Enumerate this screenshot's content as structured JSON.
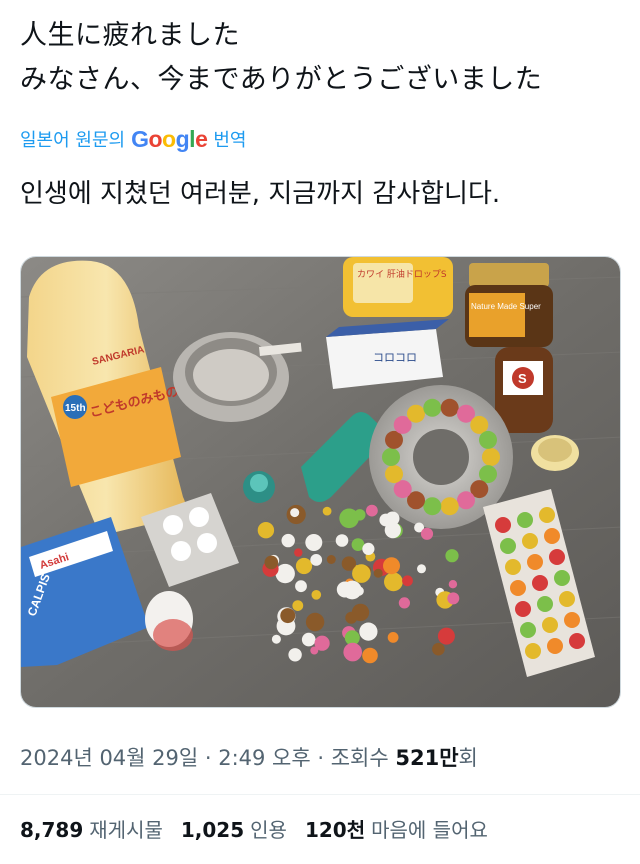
{
  "tweet": {
    "line1": "人生に疲れました",
    "line2": "みなさん、今までありがとうございました"
  },
  "translation": {
    "prefix": "일본어 원문의",
    "provider_letters": [
      "G",
      "o",
      "o",
      "g",
      "l",
      "e"
    ],
    "suffix": "번역",
    "text": "인생에 지쳤던 여러분, 지금까지 감사합니다."
  },
  "photo": {
    "bottle_brand": "SANGARIA",
    "bottle_badge": "15th",
    "bottle_label": "こどものみもの",
    "can_label": "カワイ 肝油ドロップS",
    "box_label": "コロコロ",
    "bottle2_label": "Nature Made Super",
    "candy_brand": "Asahi",
    "candy_label": "CALPIS"
  },
  "meta": {
    "datetime": "2024년 04월 29일 · 2:49 오후 · 조회수",
    "views": "521만",
    "views_unit": "회"
  },
  "stats": [
    {
      "value": "8,789",
      "label": "재게시물"
    },
    {
      "value": "1,025",
      "label": "인용"
    },
    {
      "value": "120천",
      "label": "마음에 들어요"
    }
  ]
}
